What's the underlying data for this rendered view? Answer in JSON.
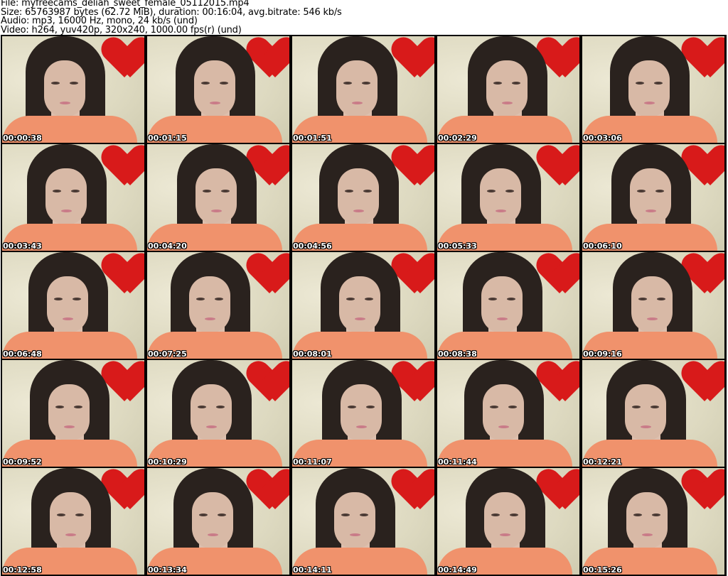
{
  "info": {
    "file": "File: myfreecams_deliah_sweet_female_05112015.mp4",
    "size": "Size: 65763987 bytes (62.72 MiB), duration: 00:16:04, avg.bitrate: 546 kb/s",
    "audio": "Audio: mp3, 16000 Hz, mono, 24 kb/s (und)",
    "video": "Video: h264, yuv420p, 320x240, 1000.00 fps(r) (und)"
  },
  "thumbnails": [
    "00:00:38",
    "00:01:15",
    "00:01:51",
    "00:02:29",
    "00:03:06",
    "00:03:43",
    "00:04:20",
    "00:04:56",
    "00:05:33",
    "00:06:10",
    "00:06:48",
    "00:07:25",
    "00:08:01",
    "00:08:38",
    "00:09:16",
    "00:09:52",
    "00:10:29",
    "00:11:07",
    "00:11:44",
    "00:12:21",
    "00:12:58",
    "00:13:34",
    "00:14:11",
    "00:14:49",
    "00:15:26"
  ]
}
